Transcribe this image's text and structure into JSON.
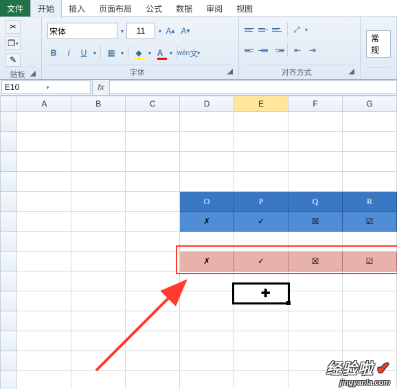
{
  "tabs": {
    "file": "文件",
    "items": [
      "开始",
      "插入",
      "页面布局",
      "公式",
      "数据",
      "审阅",
      "视图"
    ],
    "active": "开始"
  },
  "clipboard": {
    "label": "贴板"
  },
  "font": {
    "name": "宋体",
    "size": "11",
    "group_label": "字体"
  },
  "align": {
    "group_label": "对齐方式"
  },
  "number": {
    "format": "常规"
  },
  "namebox": "E10",
  "cols": [
    "A",
    "B",
    "C",
    "D",
    "E",
    "F",
    "G"
  ],
  "blue_table": {
    "headers": [
      "O",
      "P",
      "Q",
      "R"
    ],
    "row": [
      "✗",
      "✓",
      "☒",
      "☑"
    ]
  },
  "pink_row": [
    "✗",
    "✓",
    "☒",
    "☑"
  ],
  "watermark": {
    "brand": "经验啦",
    "url": "jingyanla.com"
  }
}
